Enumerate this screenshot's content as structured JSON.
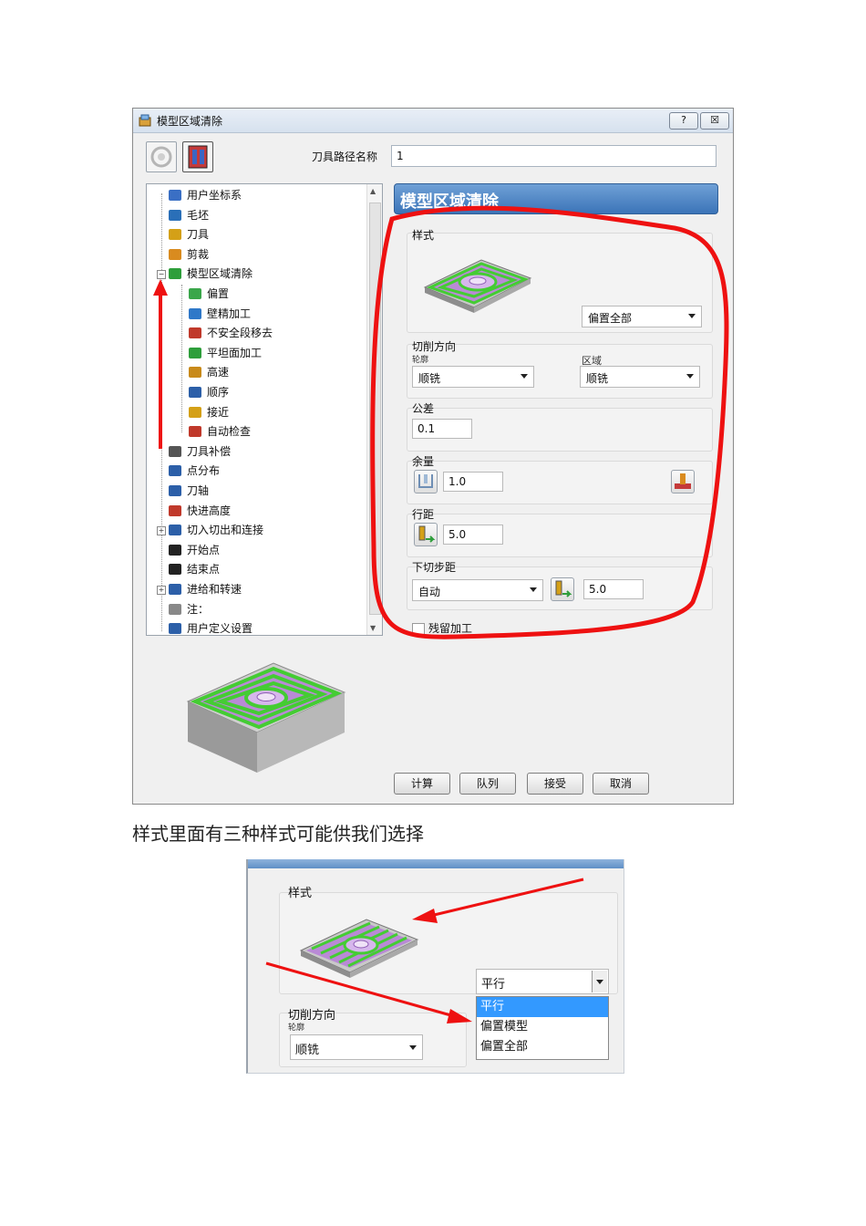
{
  "dialog": {
    "title": "模型区域清除",
    "help_button": "?",
    "close_button": "☒",
    "toolpath_name_label": "刀具路径名称",
    "toolpath_name_value": "1",
    "tree_items": [
      {
        "label": "用户坐标系",
        "icon": "ucs-icon",
        "color": "#3a6fc4"
      },
      {
        "label": "毛坯",
        "icon": "block-icon",
        "color": "#2a6fb8"
      },
      {
        "label": "刀具",
        "icon": "tool-icon",
        "color": "#d4a017"
      },
      {
        "label": "剪裁",
        "icon": "trim-icon",
        "color": "#d98b1f"
      },
      {
        "label": "模型区域清除",
        "icon": "model-area-clear-icon",
        "color": "#2e9e3b"
      },
      {
        "label": "偏置",
        "icon": "offset-icon",
        "color": "#3aa64a"
      },
      {
        "label": "壁精加工",
        "icon": "wall-finish-icon",
        "color": "#2f78c8"
      },
      {
        "label": "不安全段移去",
        "icon": "unsafe-segment-icon",
        "color": "#c0392b"
      },
      {
        "label": "平坦面加工",
        "icon": "flat-machining-icon",
        "color": "#2e9e3b"
      },
      {
        "label": "高速",
        "icon": "high-speed-icon",
        "color": "#c88a1a"
      },
      {
        "label": "顺序",
        "icon": "order-icon",
        "color": "#2c5fa8"
      },
      {
        "label": "接近",
        "icon": "approach-icon",
        "color": "#d4a017"
      },
      {
        "label": "自动检查",
        "icon": "auto-verify-icon",
        "color": "#c0392b"
      },
      {
        "label": "刀具补偿",
        "icon": "tool-comp-icon",
        "color": "#555555"
      },
      {
        "label": "点分布",
        "icon": "point-distribution-icon",
        "color": "#2c5fa8"
      },
      {
        "label": "刀轴",
        "icon": "tool-axis-icon",
        "color": "#2c5fa8"
      },
      {
        "label": "快进高度",
        "icon": "rapid-height-icon",
        "color": "#c0392b"
      },
      {
        "label": "切入切出和连接",
        "icon": "leads-links-icon",
        "color": "#2c5fa8"
      },
      {
        "label": "开始点",
        "icon": "start-point-icon",
        "color": "#222222"
      },
      {
        "label": "结束点",
        "icon": "end-point-icon",
        "color": "#222222"
      },
      {
        "label": "进给和转速",
        "icon": "feeds-speeds-icon",
        "color": "#2c5fa8"
      },
      {
        "label": "注：",
        "icon": "notes-icon",
        "color": "#888888"
      },
      {
        "label": "用户定义设置",
        "icon": "user-defined-icon",
        "color": "#2c5fa8"
      }
    ],
    "panel_title": "模型区域清除",
    "style_group": "样式",
    "style_value": "偏置全部",
    "cut_direction_group": "切削方向",
    "profile_label": "轮廓",
    "profile_value": "顺铣",
    "area_label": "区域",
    "area_value": "顺铣",
    "tolerance_group": "公差",
    "tolerance_value": "0.1",
    "allowance_group": "余量",
    "allowance_value": "1.0",
    "stepover_group": "行距",
    "stepover_value": "5.0",
    "stepdown_group": "下切步距",
    "stepdown_mode": "自动",
    "stepdown_value": "5.0",
    "truncated_label": "残留加工",
    "buttons": {
      "calculate": "计算",
      "queue": "队列",
      "accept": "接受",
      "cancel": "取消"
    }
  },
  "caption": "样式里面有三种样式可能供我们选择",
  "zoom": {
    "style_group": "样式",
    "selected_style": "平行",
    "options": [
      "平行",
      "偏置模型",
      "偏置全部"
    ],
    "cut_direction_group": "切削方向",
    "profile_label": "轮廓",
    "profile_value": "顺铣"
  },
  "colors": {
    "annotation_red": "#ee1111",
    "panel_blue": "#3b74b8",
    "toolpath_green": "#44cc33",
    "surface_purple": "#b98ad6"
  }
}
